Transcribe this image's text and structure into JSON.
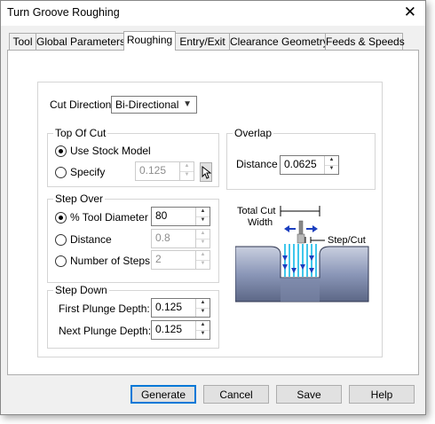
{
  "window": {
    "title": "Turn Groove Roughing"
  },
  "tabs": [
    "Tool",
    "Global Parameters",
    "Roughing",
    "Entry/Exit",
    "Clearance Geometry",
    "Feeds & Speeds"
  ],
  "cut_direction": {
    "label": "Cut Direction:",
    "value": "Bi-Directional"
  },
  "top_of_cut": {
    "title": "Top Of Cut",
    "use_stock_model": "Use Stock Model",
    "specify": "Specify",
    "specify_value": "0.125"
  },
  "overlap": {
    "title": "Overlap",
    "distance_label": "Distance",
    "distance_value": "0.0625"
  },
  "step_over": {
    "title": "Step Over",
    "tool_diameter_label": "% Tool Diameter",
    "tool_diameter_value": "80",
    "distance_label": "Distance",
    "distance_value": "0.8",
    "num_steps_label": "Number of Steps",
    "num_steps_value": "2"
  },
  "step_down": {
    "title": "Step Down",
    "first_plunge_label": "First Plunge Depth:",
    "first_plunge_value": "0.125",
    "next_plunge_label": "Next Plunge Depth:",
    "next_plunge_value": "0.125"
  },
  "diagram": {
    "total_cut_line1": "Total Cut",
    "total_cut_line2": "Width",
    "step_cut": "Step/Cut"
  },
  "buttons": {
    "generate": "Generate",
    "cancel": "Cancel",
    "save": "Save",
    "help": "Help"
  },
  "colors": {
    "accent": "#0078d7",
    "arrow": "#1b3fbf",
    "cut_lines": "#00b4e6",
    "stock": "#8b97b8"
  }
}
